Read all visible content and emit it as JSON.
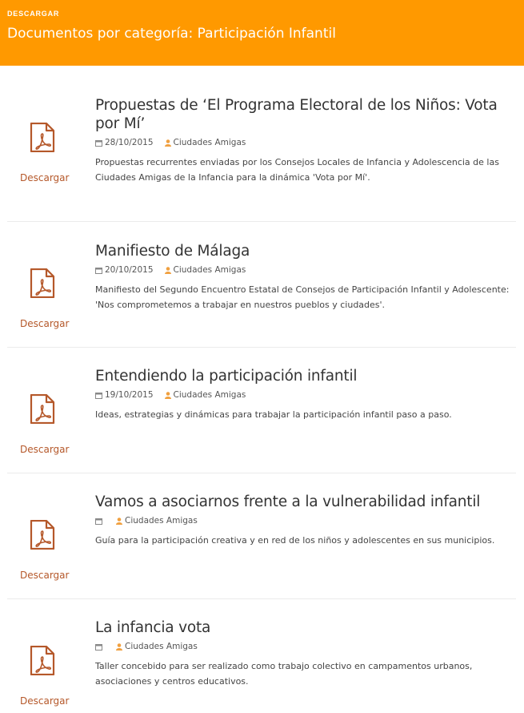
{
  "header": {
    "eyebrow": "DESCARGAR",
    "title": "Documentos por categoría: Participación Infantil"
  },
  "colors": {
    "header_bg": "#ff9900",
    "link": "#b5582a",
    "icon": "#b5582a",
    "meta_icon": "#f0a040"
  },
  "items": [
    {
      "title": "Propuestas de ‘El Programa Electoral de los Niños: Vota por Mí’",
      "date": "28/10/2015",
      "author": "Ciudades Amigas",
      "description": "Propuestas recurrentes enviadas por los Consejos Locales de Infancia y Adolescencia de las Ciudades Amigas de la Infancia para la dinámica 'Vota por Mí'.",
      "download_label": "Descargar",
      "icon": "pdf-icon"
    },
    {
      "title": "Manifiesto de Málaga",
      "date": "20/10/2015",
      "author": "Ciudades Amigas",
      "description": "Manifiesto del Segundo Encuentro Estatal de Consejos de Participación Infantil y Adolescente: 'Nos comprometemos a trabajar en nuestros pueblos y ciudades'.",
      "download_label": "Descargar",
      "icon": "pdf-icon"
    },
    {
      "title": "Entendiendo la participación infantil",
      "date": "19/10/2015",
      "author": "Ciudades Amigas",
      "description": "Ideas, estrategias y dinámicas para trabajar la participación infantil paso a paso.",
      "download_label": "Descargar",
      "icon": "pdf-icon"
    },
    {
      "title": "Vamos a asociarnos frente a la vulnerabilidad infantil",
      "date": "",
      "author": "Ciudades Amigas",
      "description": "Guía para la participación creativa y en red de los niños y adolescentes en sus municipios.",
      "download_label": "Descargar",
      "icon": "pdf-icon"
    },
    {
      "title": "La infancia vota",
      "date": "",
      "author": "Ciudades Amigas",
      "description": "Taller concebido para ser realizado como trabajo colectivo en campamentos urbanos, asociaciones y centros educativos.",
      "download_label": "Descargar",
      "icon": "pdf-icon"
    }
  ]
}
